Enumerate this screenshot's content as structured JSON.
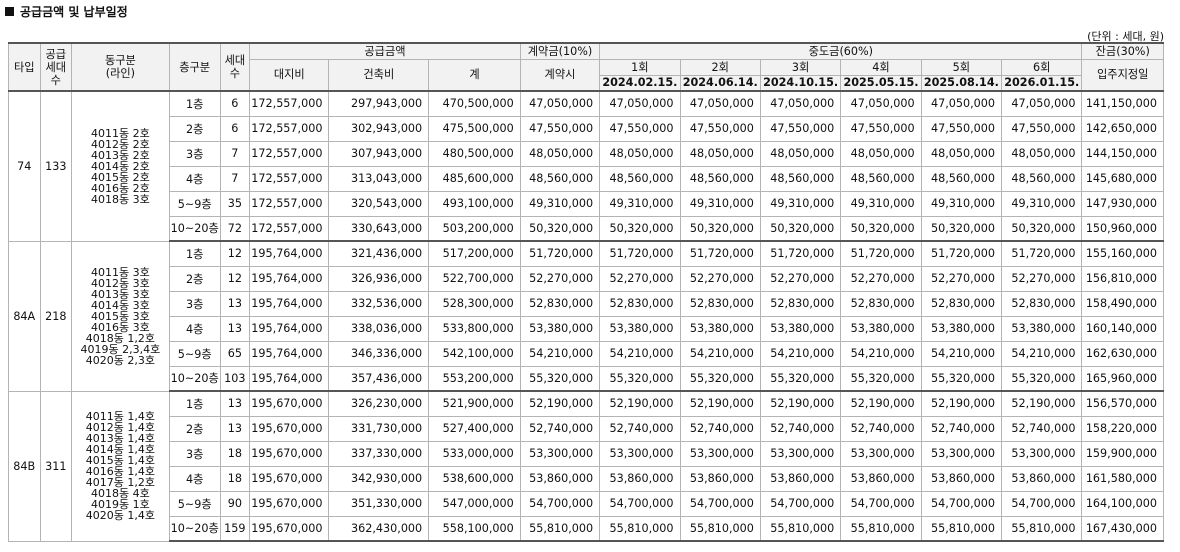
{
  "title": "공급금액 및 납부일정",
  "unit": "(단위 : 세대, 원)",
  "headers": {
    "type": "타입",
    "supply_units": "공급세대수",
    "dong": "동구분(라인)",
    "floor": "층구분",
    "units": "세대수",
    "supply_price": "공급금액",
    "land": "대지비",
    "building": "건축비",
    "total": "계",
    "deposit": "계약금(10%)",
    "deposit_sub": "계약시",
    "middle": "중도금(60%)",
    "balance": "잔금(30%)",
    "balance_sub": "입주지정일",
    "installments": [
      {
        "label": "1회",
        "date": "2024.02.15."
      },
      {
        "label": "2회",
        "date": "2024.06.14."
      },
      {
        "label": "3회",
        "date": "2024.10.15."
      },
      {
        "label": "4회",
        "date": "2025.05.15."
      },
      {
        "label": "5회",
        "date": "2025.08.14."
      },
      {
        "label": "6회",
        "date": "2026.01.15."
      }
    ]
  },
  "groups": [
    {
      "type": "74",
      "supply": "133",
      "dongs": [
        "4011동 2호",
        "4012동 2호",
        "4013동 2호",
        "4014동 2호",
        "4015동 2호",
        "4016동 2호",
        "4018동 3호"
      ],
      "rows": [
        {
          "floor": "1층",
          "units": "6",
          "land": "172,557,000",
          "building": "297,943,000",
          "total": "470,500,000",
          "deposit": "47,050,000",
          "mid": "47,050,000",
          "balance": "141,150,000"
        },
        {
          "floor": "2층",
          "units": "6",
          "land": "172,557,000",
          "building": "302,943,000",
          "total": "475,500,000",
          "deposit": "47,550,000",
          "mid": "47,550,000",
          "balance": "142,650,000"
        },
        {
          "floor": "3층",
          "units": "7",
          "land": "172,557,000",
          "building": "307,943,000",
          "total": "480,500,000",
          "deposit": "48,050,000",
          "mid": "48,050,000",
          "balance": "144,150,000"
        },
        {
          "floor": "4층",
          "units": "7",
          "land": "172,557,000",
          "building": "313,043,000",
          "total": "485,600,000",
          "deposit": "48,560,000",
          "mid": "48,560,000",
          "balance": "145,680,000"
        },
        {
          "floor": "5~9층",
          "units": "35",
          "land": "172,557,000",
          "building": "320,543,000",
          "total": "493,100,000",
          "deposit": "49,310,000",
          "mid": "49,310,000",
          "balance": "147,930,000"
        },
        {
          "floor": "10~20층",
          "units": "72",
          "land": "172,557,000",
          "building": "330,643,000",
          "total": "503,200,000",
          "deposit": "50,320,000",
          "mid": "50,320,000",
          "balance": "150,960,000"
        }
      ]
    },
    {
      "type": "84A",
      "supply": "218",
      "dongs": [
        "4011동 3호",
        "4012동 3호",
        "4013동 3호",
        "4014동 3호",
        "4015동 3호",
        "4016동 3호",
        "4018동 1,2호",
        "4019동 2,3,4호",
        "4020동 2,3호"
      ],
      "rows": [
        {
          "floor": "1층",
          "units": "12",
          "land": "195,764,000",
          "building": "321,436,000",
          "total": "517,200,000",
          "deposit": "51,720,000",
          "mid": "51,720,000",
          "balance": "155,160,000"
        },
        {
          "floor": "2층",
          "units": "12",
          "land": "195,764,000",
          "building": "326,936,000",
          "total": "522,700,000",
          "deposit": "52,270,000",
          "mid": "52,270,000",
          "balance": "156,810,000"
        },
        {
          "floor": "3층",
          "units": "13",
          "land": "195,764,000",
          "building": "332,536,000",
          "total": "528,300,000",
          "deposit": "52,830,000",
          "mid": "52,830,000",
          "balance": "158,490,000"
        },
        {
          "floor": "4층",
          "units": "13",
          "land": "195,764,000",
          "building": "338,036,000",
          "total": "533,800,000",
          "deposit": "53,380,000",
          "mid": "53,380,000",
          "balance": "160,140,000"
        },
        {
          "floor": "5~9층",
          "units": "65",
          "land": "195,764,000",
          "building": "346,336,000",
          "total": "542,100,000",
          "deposit": "54,210,000",
          "mid": "54,210,000",
          "balance": "162,630,000"
        },
        {
          "floor": "10~20층",
          "units": "103",
          "land": "195,764,000",
          "building": "357,436,000",
          "total": "553,200,000",
          "deposit": "55,320,000",
          "mid": "55,320,000",
          "balance": "165,960,000"
        }
      ]
    },
    {
      "type": "84B",
      "supply": "311",
      "dongs": [
        "4011동 1,4호",
        "4012동 1,4호",
        "4013동 1,4호",
        "4014동 1,4호",
        "4015동 1,4호",
        "4016동 1,4호",
        "4017동 1,2호",
        "4018동 4호",
        "4019동 1호",
        "4020동 1,4호"
      ],
      "rows": [
        {
          "floor": "1층",
          "units": "13",
          "land": "195,670,000",
          "building": "326,230,000",
          "total": "521,900,000",
          "deposit": "52,190,000",
          "mid": "52,190,000",
          "balance": "156,570,000"
        },
        {
          "floor": "2층",
          "units": "13",
          "land": "195,670,000",
          "building": "331,730,000",
          "total": "527,400,000",
          "deposit": "52,740,000",
          "mid": "52,740,000",
          "balance": "158,220,000"
        },
        {
          "floor": "3층",
          "units": "18",
          "land": "195,670,000",
          "building": "337,330,000",
          "total": "533,000,000",
          "deposit": "53,300,000",
          "mid": "53,300,000",
          "balance": "159,900,000"
        },
        {
          "floor": "4층",
          "units": "18",
          "land": "195,670,000",
          "building": "342,930,000",
          "total": "538,600,000",
          "deposit": "53,860,000",
          "mid": "53,860,000",
          "balance": "161,580,000"
        },
        {
          "floor": "5~9층",
          "units": "90",
          "land": "195,670,000",
          "building": "351,330,000",
          "total": "547,000,000",
          "deposit": "54,700,000",
          "mid": "54,700,000",
          "balance": "164,100,000"
        },
        {
          "floor": "10~20층",
          "units": "159",
          "land": "195,670,000",
          "building": "362,430,000",
          "total": "558,100,000",
          "deposit": "55,810,000",
          "mid": "55,810,000",
          "balance": "167,430,000"
        }
      ]
    }
  ]
}
